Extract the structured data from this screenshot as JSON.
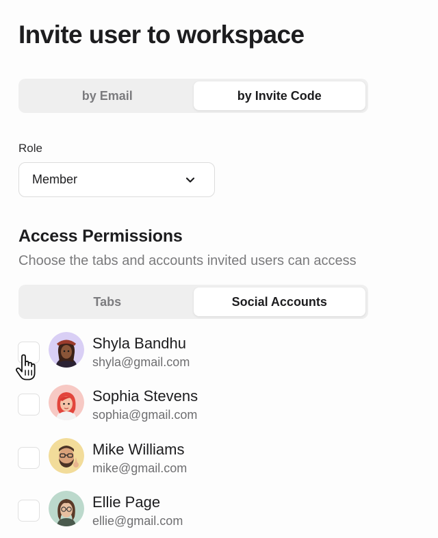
{
  "page": {
    "title": "Invite user to workspace"
  },
  "invite_method": {
    "options": [
      {
        "label": "by Email",
        "active": false
      },
      {
        "label": "by Invite Code",
        "active": true
      }
    ]
  },
  "role": {
    "label": "Role",
    "value": "Member",
    "icon": "chevron-down-icon"
  },
  "access": {
    "title": "Access Permissions",
    "subtitle": "Choose the tabs and accounts invited users can access",
    "tabs": [
      {
        "label": "Tabs",
        "active": false
      },
      {
        "label": "Social Accounts",
        "active": true
      }
    ]
  },
  "accounts": [
    {
      "name": "Shyla Bandhu",
      "email": "shyla@gmail.com",
      "checked": false,
      "avatar_color": "#d9cff5"
    },
    {
      "name": "Sophia Stevens",
      "email": "sophia@gmail.com",
      "checked": false,
      "avatar_color": "#f7c9c4"
    },
    {
      "name": "Mike Williams",
      "email": "mike@gmail.com",
      "checked": false,
      "avatar_color": "#f2dc9a"
    },
    {
      "name": "Ellie Page",
      "email": "ellie@gmail.com",
      "checked": false,
      "avatar_color": "#bcd9cc"
    }
  ],
  "colors": {
    "segment_bg": "#efefef",
    "segment_active": "#ffffff",
    "text_primary": "#1c1c1e",
    "text_muted": "#7a7a7c"
  }
}
